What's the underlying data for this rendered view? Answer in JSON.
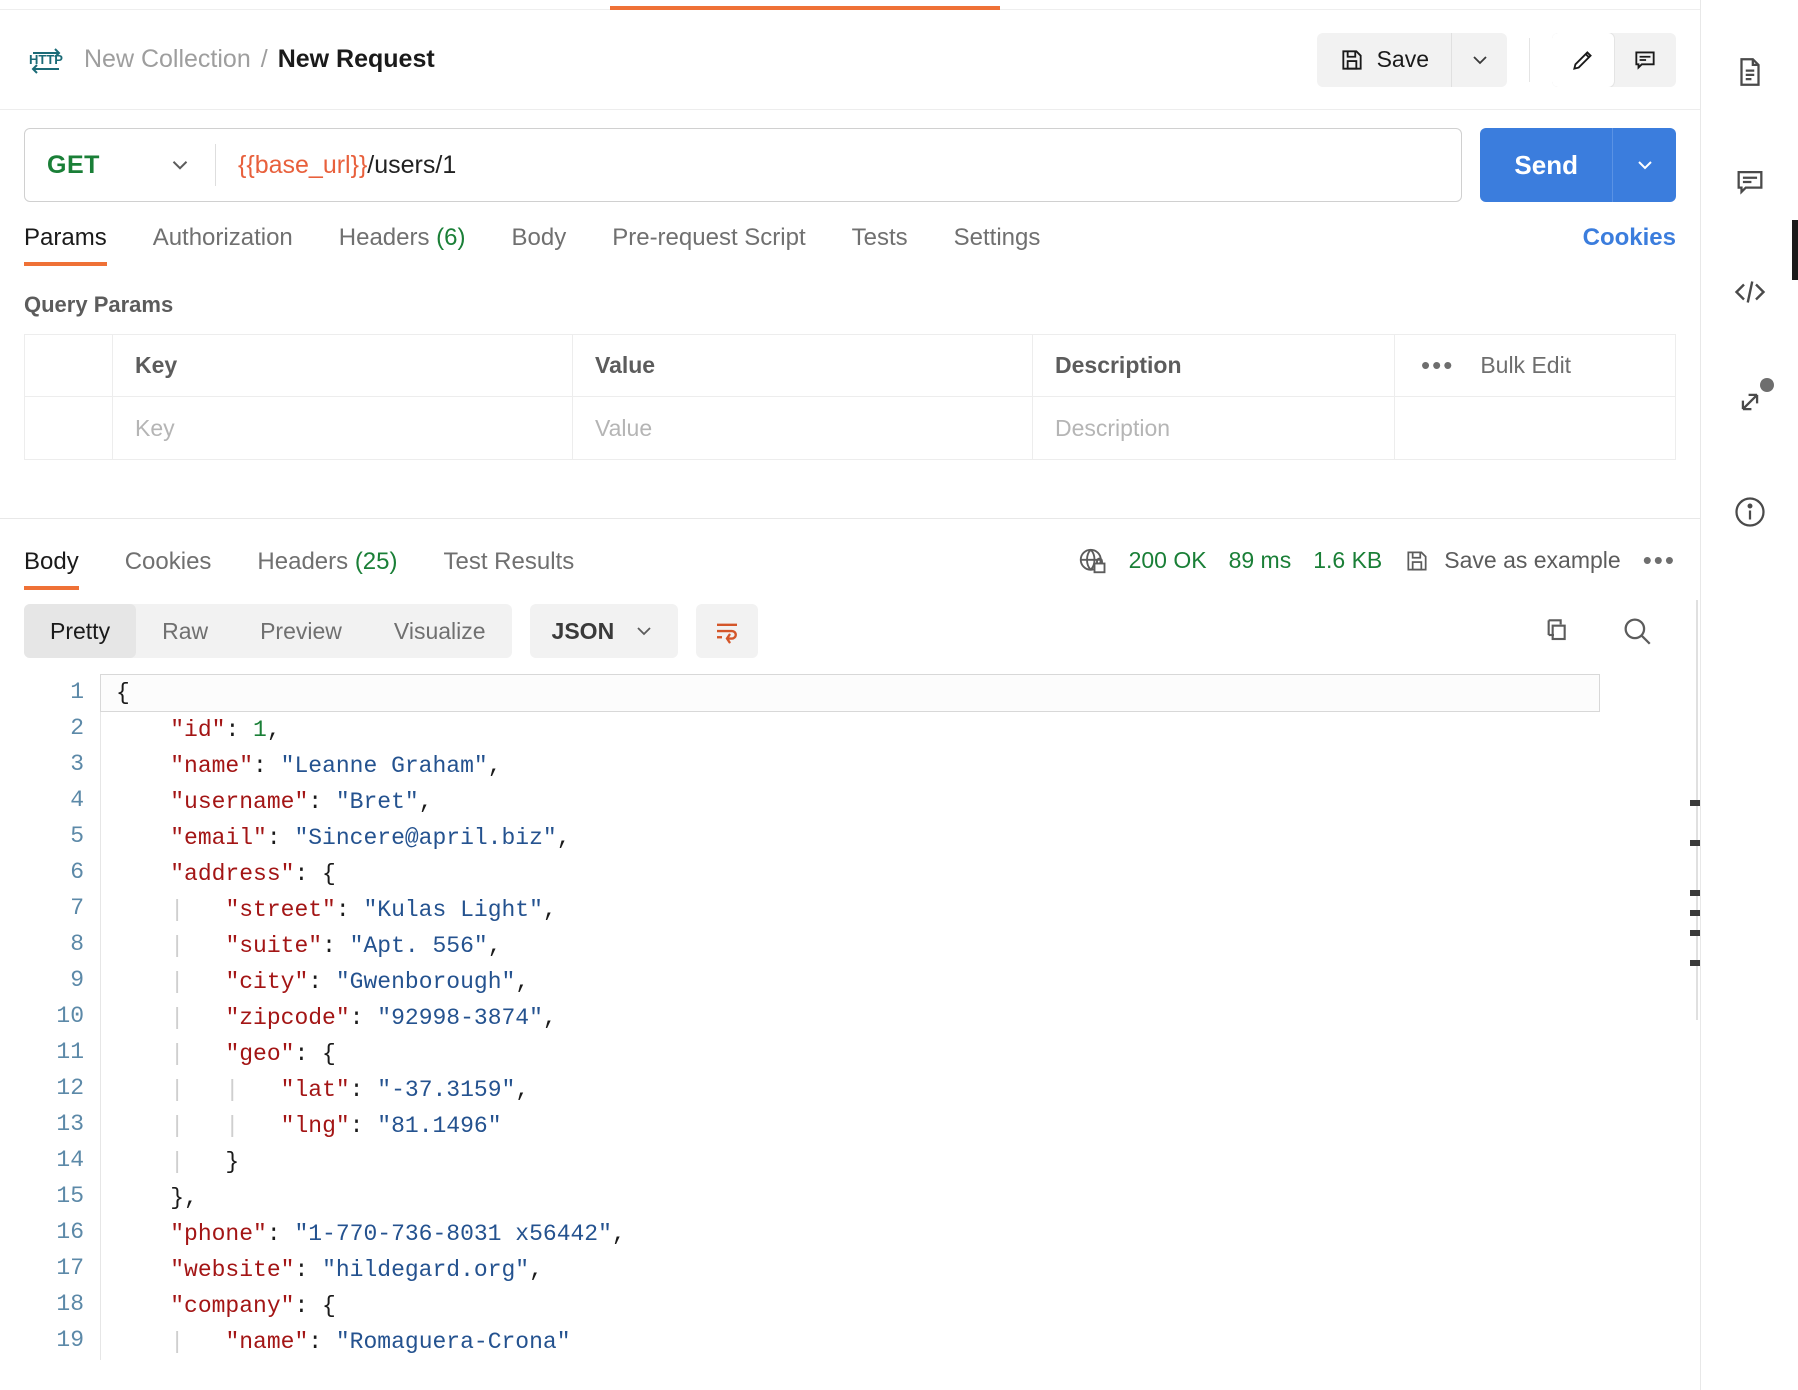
{
  "breadcrumb": {
    "collection": "New Collection",
    "separator": "/",
    "request": "New Request",
    "protocol_icon": "http-icon"
  },
  "header_actions": {
    "save_label": "Save",
    "save_caret": "chevron-down-icon",
    "edit_icon": "pencil-icon",
    "comment_icon": "comment-icon"
  },
  "url_bar": {
    "method": "GET",
    "method_caret": "chevron-down-icon",
    "url_variable": "{{base_url}}",
    "url_path": "/users/1",
    "send_label": "Send",
    "send_caret": "chevron-down-icon"
  },
  "request_tabs": [
    {
      "label": "Params",
      "count": "",
      "active": true
    },
    {
      "label": "Authorization",
      "count": "",
      "active": false
    },
    {
      "label": "Headers",
      "count": "(6)",
      "active": false
    },
    {
      "label": "Body",
      "count": "",
      "active": false
    },
    {
      "label": "Pre-request Script",
      "count": "",
      "active": false
    },
    {
      "label": "Tests",
      "count": "",
      "active": false
    },
    {
      "label": "Settings",
      "count": "",
      "active": false
    }
  ],
  "cookies_link": "Cookies",
  "query_params": {
    "section_title": "Query Params",
    "columns": [
      "Key",
      "Value",
      "Description"
    ],
    "bulk_edit_label": "Bulk Edit",
    "overflow_icon": "ellipsis-icon",
    "placeholder_row": {
      "key": "Key",
      "value": "Value",
      "description": "Description"
    }
  },
  "response": {
    "tabs": [
      {
        "label": "Body",
        "count": "",
        "active": true
      },
      {
        "label": "Cookies",
        "count": "",
        "active": false
      },
      {
        "label": "Headers",
        "count": "(25)",
        "active": false
      },
      {
        "label": "Test Results",
        "count": "",
        "active": false
      }
    ],
    "network_icon": "globe-lock-icon",
    "status": "200 OK",
    "time": "89 ms",
    "size": "1.6 KB",
    "save_example_label": "Save as example",
    "save_example_icon": "floppy-icon",
    "more_icon": "ellipsis-icon",
    "view_modes": [
      {
        "label": "Pretty",
        "active": true
      },
      {
        "label": "Raw",
        "active": false
      },
      {
        "label": "Preview",
        "active": false
      },
      {
        "label": "Visualize",
        "active": false
      }
    ],
    "format": "JSON",
    "format_caret": "chevron-down-icon",
    "wrap_icon": "wrap-lines-icon",
    "copy_icon": "copy-icon",
    "search_icon": "search-icon"
  },
  "body_code": {
    "lines": [
      {
        "num": "1",
        "tokens": [
          {
            "t": "p",
            "v": "{"
          }
        ]
      },
      {
        "num": "2",
        "tokens": [
          {
            "t": "p",
            "v": "    "
          },
          {
            "t": "k",
            "v": "\"id\""
          },
          {
            "t": "p",
            "v": ": "
          },
          {
            "t": "n",
            "v": "1"
          },
          {
            "t": "p",
            "v": ","
          }
        ]
      },
      {
        "num": "3",
        "tokens": [
          {
            "t": "p",
            "v": "    "
          },
          {
            "t": "k",
            "v": "\"name\""
          },
          {
            "t": "p",
            "v": ": "
          },
          {
            "t": "s",
            "v": "\"Leanne Graham\""
          },
          {
            "t": "p",
            "v": ","
          }
        ]
      },
      {
        "num": "4",
        "tokens": [
          {
            "t": "p",
            "v": "    "
          },
          {
            "t": "k",
            "v": "\"username\""
          },
          {
            "t": "p",
            "v": ": "
          },
          {
            "t": "s",
            "v": "\"Bret\""
          },
          {
            "t": "p",
            "v": ","
          }
        ]
      },
      {
        "num": "5",
        "tokens": [
          {
            "t": "p",
            "v": "    "
          },
          {
            "t": "k",
            "v": "\"email\""
          },
          {
            "t": "p",
            "v": ": "
          },
          {
            "t": "s",
            "v": "\"Sincere@april.biz\""
          },
          {
            "t": "p",
            "v": ","
          }
        ]
      },
      {
        "num": "6",
        "tokens": [
          {
            "t": "p",
            "v": "    "
          },
          {
            "t": "k",
            "v": "\"address\""
          },
          {
            "t": "p",
            "v": ": {"
          }
        ]
      },
      {
        "num": "7",
        "tokens": [
          {
            "t": "ind",
            "v": "    |"
          },
          {
            "t": "p",
            "v": "   "
          },
          {
            "t": "k",
            "v": "\"street\""
          },
          {
            "t": "p",
            "v": ": "
          },
          {
            "t": "s",
            "v": "\"Kulas Light\""
          },
          {
            "t": "p",
            "v": ","
          }
        ]
      },
      {
        "num": "8",
        "tokens": [
          {
            "t": "ind",
            "v": "    |"
          },
          {
            "t": "p",
            "v": "   "
          },
          {
            "t": "k",
            "v": "\"suite\""
          },
          {
            "t": "p",
            "v": ": "
          },
          {
            "t": "s",
            "v": "\"Apt. 556\""
          },
          {
            "t": "p",
            "v": ","
          }
        ]
      },
      {
        "num": "9",
        "tokens": [
          {
            "t": "ind",
            "v": "    |"
          },
          {
            "t": "p",
            "v": "   "
          },
          {
            "t": "k",
            "v": "\"city\""
          },
          {
            "t": "p",
            "v": ": "
          },
          {
            "t": "s",
            "v": "\"Gwenborough\""
          },
          {
            "t": "p",
            "v": ","
          }
        ]
      },
      {
        "num": "10",
        "tokens": [
          {
            "t": "ind",
            "v": "    |"
          },
          {
            "t": "p",
            "v": "   "
          },
          {
            "t": "k",
            "v": "\"zipcode\""
          },
          {
            "t": "p",
            "v": ": "
          },
          {
            "t": "s",
            "v": "\"92998-3874\""
          },
          {
            "t": "p",
            "v": ","
          }
        ]
      },
      {
        "num": "11",
        "tokens": [
          {
            "t": "ind",
            "v": "    |"
          },
          {
            "t": "p",
            "v": "   "
          },
          {
            "t": "k",
            "v": "\"geo\""
          },
          {
            "t": "p",
            "v": ": {"
          }
        ]
      },
      {
        "num": "12",
        "tokens": [
          {
            "t": "ind",
            "v": "    |   |"
          },
          {
            "t": "p",
            "v": "   "
          },
          {
            "t": "k",
            "v": "\"lat\""
          },
          {
            "t": "p",
            "v": ": "
          },
          {
            "t": "s",
            "v": "\"-37.3159\""
          },
          {
            "t": "p",
            "v": ","
          }
        ]
      },
      {
        "num": "13",
        "tokens": [
          {
            "t": "ind",
            "v": "    |   |"
          },
          {
            "t": "p",
            "v": "   "
          },
          {
            "t": "k",
            "v": "\"lng\""
          },
          {
            "t": "p",
            "v": ": "
          },
          {
            "t": "s",
            "v": "\"81.1496\""
          }
        ]
      },
      {
        "num": "14",
        "tokens": [
          {
            "t": "ind",
            "v": "    |"
          },
          {
            "t": "p",
            "v": "   }"
          }
        ]
      },
      {
        "num": "15",
        "tokens": [
          {
            "t": "p",
            "v": "    },"
          }
        ]
      },
      {
        "num": "16",
        "tokens": [
          {
            "t": "p",
            "v": "    "
          },
          {
            "t": "k",
            "v": "\"phone\""
          },
          {
            "t": "p",
            "v": ": "
          },
          {
            "t": "s",
            "v": "\"1-770-736-8031 x56442\""
          },
          {
            "t": "p",
            "v": ","
          }
        ]
      },
      {
        "num": "17",
        "tokens": [
          {
            "t": "p",
            "v": "    "
          },
          {
            "t": "k",
            "v": "\"website\""
          },
          {
            "t": "p",
            "v": ": "
          },
          {
            "t": "s",
            "v": "\"hildegard.org\""
          },
          {
            "t": "p",
            "v": ","
          }
        ]
      },
      {
        "num": "18",
        "tokens": [
          {
            "t": "p",
            "v": "    "
          },
          {
            "t": "k",
            "v": "\"company\""
          },
          {
            "t": "p",
            "v": ": {"
          }
        ]
      },
      {
        "num": "19",
        "tokens": [
          {
            "t": "ind",
            "v": "    |"
          },
          {
            "t": "p",
            "v": "   "
          },
          {
            "t": "k",
            "v": "\"name\""
          },
          {
            "t": "p",
            "v": ": "
          },
          {
            "t": "s",
            "v": "\"Romaguera-Crona\""
          }
        ]
      }
    ]
  },
  "right_rail": [
    {
      "icon": "documentation-icon"
    },
    {
      "icon": "comment-icon"
    },
    {
      "icon": "code-icon"
    },
    {
      "icon": "sync-icon",
      "badge": true
    },
    {
      "icon": "info-icon"
    }
  ],
  "colors": {
    "accent_orange": "#ef7136",
    "send_blue": "#3b7ddd",
    "status_green": "#1a7f37",
    "json_key": "#a31515",
    "json_string": "#24528f",
    "json_number": "#1a7f37",
    "url_variable": "#e8603c"
  }
}
